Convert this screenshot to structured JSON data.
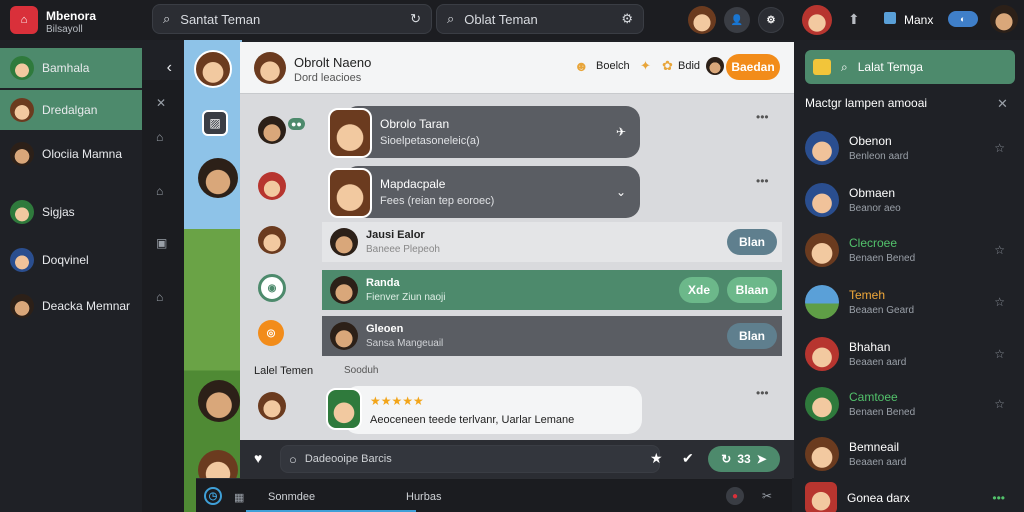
{
  "app": {
    "title": "Mbenora",
    "subtitle": "Bilsayoll"
  },
  "topbar": {
    "search1_text": "Santat Teman",
    "search2_text": "Oblat Teman",
    "user_name": "Manx"
  },
  "sidebar": {
    "items": [
      {
        "label": "Bamhala",
        "active": true
      },
      {
        "label": "Dredalgan",
        "active": true
      },
      {
        "label": "Olociia Mamna",
        "active": false
      },
      {
        "label": "Sigjas",
        "active": false
      },
      {
        "label": "Doqvinel",
        "active": false
      },
      {
        "label": "Deacka Memnar",
        "active": false
      }
    ]
  },
  "chat": {
    "header_name": "Obrolt Naeno",
    "header_sub": "Dord leacioes",
    "header_action_1": "Boelch",
    "header_action_2": "Bdid",
    "header_button": "Baedan",
    "messages": [
      {
        "name": "Obrolo Taran",
        "text": "Sioelpetasoneleic(a)"
      },
      {
        "name": "Mapdacpale",
        "text": "Fees (reian tep eoroec)"
      }
    ],
    "rows": [
      {
        "name": "Jausi Ealor",
        "sub": "Baneee Plepeoh",
        "button": "Blan"
      },
      {
        "name": "Randa",
        "sub": "Fienver Ziun naoji",
        "button_1": "Xde",
        "button_2": "Blaan"
      },
      {
        "name": "Gleoen",
        "sub": "Sansa Mangeuail",
        "button": "Blan"
      }
    ],
    "section_label": "Lalel Temen",
    "section_sub": "Sooduh",
    "rating_text": "Aeoceneen teede terlvanr,",
    "rating_suffix": "Uarlar Lemane",
    "input_placeholder": "Dadeooipe Barcis",
    "count_badge": "33"
  },
  "rightpanel": {
    "search_text": "Lalat Temga",
    "title": "Mactgr lampen amooai",
    "friends": [
      {
        "name": "Obenon",
        "status": "Benleon aard",
        "name_color": "#ffffff"
      },
      {
        "name": "Obmaen",
        "status": "Beanor aeo",
        "name_color": "#ffffff"
      },
      {
        "name": "Clecroee",
        "status": "Benaen Bened",
        "name_color": "#52c26b"
      },
      {
        "name": "Temeh",
        "status": "Beaaen Geard",
        "name_color": "#f0a83a"
      },
      {
        "name": "Bhahan",
        "status": "Beaaen aard",
        "name_color": "#ffffff"
      },
      {
        "name": "Camtoee",
        "status": "Benaen Bened",
        "name_color": "#52c26b"
      },
      {
        "name": "Bemneail",
        "status": "Beaaen aard",
        "name_color": "#ffffff"
      },
      {
        "name": "Gonea darx",
        "status": "",
        "name_color": "#ffffff"
      }
    ]
  },
  "bottombar": {
    "label_1": "Sonmdee",
    "label_2": "Hurbas"
  },
  "colors": {
    "accent_green": "#4d8a6c",
    "orange_button": "#f28c1a",
    "steel_button": "#5f7f8e"
  }
}
